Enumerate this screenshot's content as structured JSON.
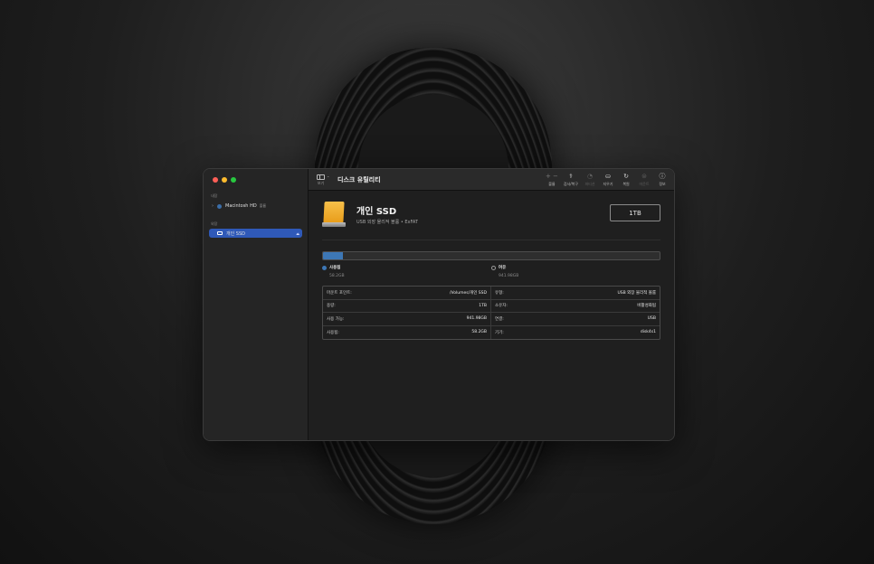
{
  "window": {
    "app_title": "디스크 유틸리티",
    "view_label": "보기"
  },
  "sidebar": {
    "sections": [
      {
        "label": "내장",
        "items": [
          {
            "label": "Macintosh HD",
            "badge": "볼륨",
            "icon": "internal-disk-icon"
          }
        ]
      },
      {
        "label": "외장",
        "items": [
          {
            "label": "개인 SSD",
            "icon": "external-disk-icon",
            "selected": true
          }
        ]
      }
    ]
  },
  "toolbar": {
    "tools": [
      {
        "name": "volume",
        "icon": "+ −",
        "label": "볼륨",
        "enabled": true
      },
      {
        "name": "first-aid",
        "icon": "⚕",
        "label": "검사/복구",
        "enabled": true
      },
      {
        "name": "partition",
        "icon": "◔",
        "label": "파티션",
        "enabled": false
      },
      {
        "name": "erase",
        "icon": "⛀",
        "label": "지우기",
        "enabled": true
      },
      {
        "name": "restore",
        "icon": "↻",
        "label": "복원",
        "enabled": true
      },
      {
        "name": "unmount",
        "icon": "⊜",
        "label": "마운트",
        "enabled": false
      },
      {
        "name": "info",
        "icon": "ⓘ",
        "label": "정보",
        "enabled": true
      }
    ]
  },
  "volume": {
    "name": "개인 SSD",
    "subtitle": "USB 외장 물리적 볼륨 • ExFAT",
    "size": "1TB"
  },
  "usage": {
    "used_fraction": 0.058,
    "used_label": "사용됨",
    "used_value": "58.2GB",
    "free_label": "여유",
    "free_value": "941.98GB",
    "used_color": "#3d77b5"
  },
  "info_rows": [
    {
      "key": "마운트 포인트:",
      "value": "/Volumes/개인 SSD"
    },
    {
      "key": "유형:",
      "value": "USB 외장 물리적 볼륨"
    },
    {
      "key": "용량:",
      "value": "1TB"
    },
    {
      "key": "소유자:",
      "value": "비활성화됨"
    },
    {
      "key": "사용 가능:",
      "value": "941.98GB"
    },
    {
      "key": "연결:",
      "value": "USB"
    },
    {
      "key": "사용됨:",
      "value": "58.2GB"
    },
    {
      "key": "기기:",
      "value": "disk4s1"
    }
  ]
}
